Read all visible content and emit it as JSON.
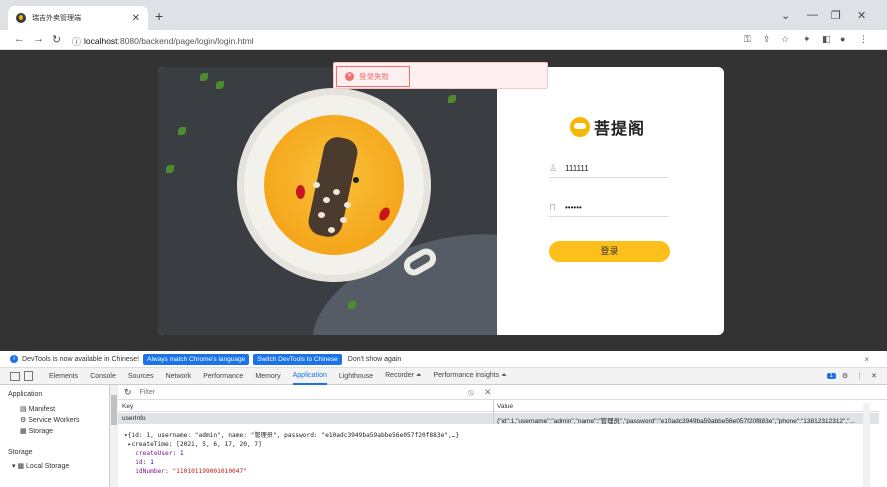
{
  "browser": {
    "tab_title": "瑞吉外卖管理端",
    "url_host": "localhost",
    "url_path": ":8080/backend/page/login/login.html"
  },
  "login": {
    "brand": "菩提阁",
    "username": "111111",
    "password": "••••••",
    "login_button": "登录",
    "error_message": "登录失败"
  },
  "devtools": {
    "infobar": {
      "message": "DevTools is now available in Chinese!",
      "btn_match": "Always match Chrome's language",
      "btn_switch": "Switch DevTools to Chinese",
      "dont_show": "Don't show again"
    },
    "tabs": [
      "Elements",
      "Console",
      "Sources",
      "Network",
      "Performance",
      "Memory",
      "Application",
      "Lighthouse",
      "Recorder ⏶",
      "Performance insights ⏶"
    ],
    "active_tab": "Application",
    "issues_count": "1",
    "sidebar": {
      "application_header": "Application",
      "manifest": "Manifest",
      "service_workers": "Service Workers",
      "storage_item": "Storage",
      "storage_header": "Storage",
      "local_storage": "Local Storage"
    },
    "filter_placeholder": "Filter",
    "table": {
      "key_header": "Key",
      "value_header": "Value",
      "key": "userInfo",
      "value": "{\"id\":1,\"username\":\"admin\",\"name\":\"管理员\",\"password\":\"e10adc3949ba59abbe56e057f20f883e\",\"phone\":\"13812312312\",\"..."
    },
    "object_preview": {
      "line1_prefix": "▾{id: 1, username: \"admin\", name: \"管理员\", password: \"e10adc3949ba59abbe56e057f20f883e\",…}",
      "line2": " ▸createTime: [2021, 5, 6, 17, 20, 7]",
      "line3_key": "createUser",
      "line3_val": "1",
      "line4_key": "id",
      "line4_val": "1",
      "line5_key": "idNumber",
      "line5_val": "\"110101199001010047\""
    }
  }
}
